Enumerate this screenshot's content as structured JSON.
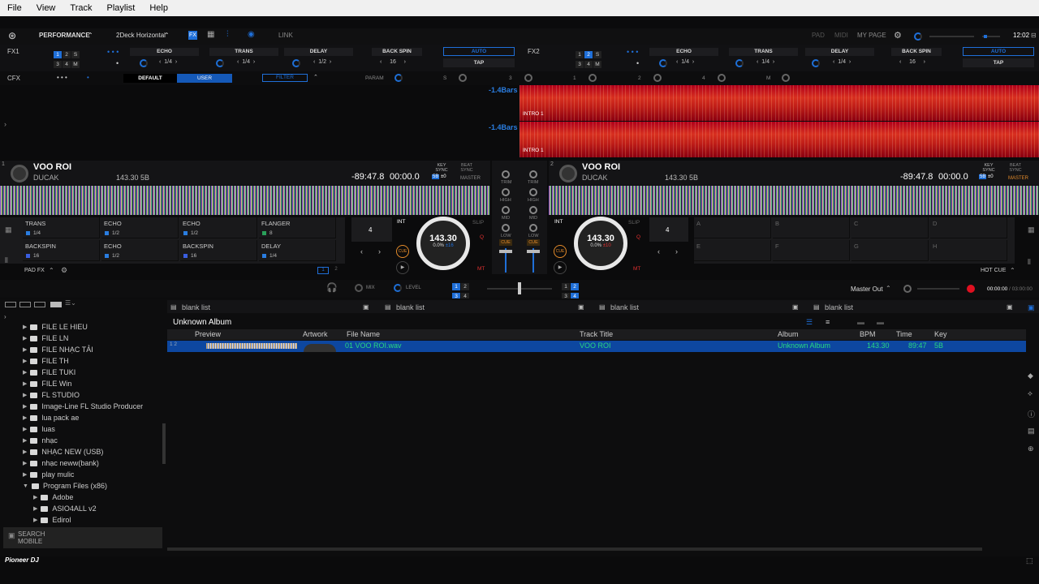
{
  "menu": [
    "File",
    "View",
    "Track",
    "Playlist",
    "Help"
  ],
  "topbar": {
    "mode": "PERFORMANCE",
    "layout": "2Deck Horizontal",
    "link": "LINK",
    "pad": "PAD",
    "midi": "MIDI",
    "mypage": "MY PAGE",
    "clock": "12:02"
  },
  "fx1": {
    "label": "FX1",
    "bank": [
      "1",
      "2",
      "S",
      "3",
      "4",
      "M"
    ],
    "slots": [
      {
        "name": "ECHO",
        "beat": "1/4"
      },
      {
        "name": "TRANS",
        "beat": "1/4"
      },
      {
        "name": "DELAY",
        "beat": "1/2"
      }
    ],
    "backspin": "BACK SPIN",
    "backspin_val": "16",
    "auto": "AUTO",
    "tap": "TAP"
  },
  "fx2": {
    "label": "FX2",
    "bank": [
      "1",
      "2",
      "S",
      "3",
      "4",
      "M"
    ],
    "slots": [
      {
        "name": "ECHO",
        "beat": "1/4"
      },
      {
        "name": "TRANS",
        "beat": "1/4"
      },
      {
        "name": "DELAY",
        "beat": "1/4"
      }
    ],
    "backspin": "BACK SPIN",
    "backspin_val": "16",
    "auto": "AUTO",
    "tap": "TAP"
  },
  "cfx": {
    "label": "CFX",
    "default": "DEFAULT",
    "user": "USER",
    "filter": "FILTER",
    "param": "PARAM",
    "s": "S",
    "nums": [
      "3",
      "1",
      "2",
      "4",
      "M"
    ]
  },
  "bars": "-1.4Bars",
  "intro": "INTRO 1",
  "deck1": {
    "num": "1",
    "title": "VOO ROI",
    "artist": "DUCAK",
    "bpmkey": "143.30 5B",
    "remain": "-89:47.8",
    "elapsed": "00:00.0",
    "keysync": "KEY SYNC",
    "beatsync": "BEAT SYNC",
    "master": "MASTER",
    "sb": "5B",
    "sb2": "±0",
    "loop": "4",
    "int": "INT",
    "slip": "SLIP",
    "cue": "CUE",
    "bpm": "143.30",
    "pitch": "0.0%",
    "range": "±16",
    "q": "Q",
    "mt": "MT",
    "padfx": "PAD FX",
    "pads": [
      {
        "label": "TRANS",
        "val": "1/4",
        "c": "#2a7de0"
      },
      {
        "label": "ECHO",
        "val": "1/2",
        "c": "#2a7de0"
      },
      {
        "label": "ECHO",
        "val": "1/2",
        "c": "#2a7de0"
      },
      {
        "label": "FLANGER",
        "val": "8",
        "c": "#2aa05a"
      },
      {
        "label": "BACKSPIN",
        "val": "16",
        "c": "#3a5ee0"
      },
      {
        "label": "ECHO",
        "val": "1/2",
        "c": "#2a7de0"
      },
      {
        "label": "BACKSPIN",
        "val": "16",
        "c": "#3a5ee0"
      },
      {
        "label": "DELAY",
        "val": "1/4",
        "c": "#2a7de0"
      }
    ],
    "page": [
      "1",
      "2"
    ]
  },
  "deck2": {
    "num": "2",
    "title": "VOO ROI",
    "artist": "DUCAK",
    "bpmkey": "143.30 5B",
    "remain": "-89:47.8",
    "elapsed": "00:00.0",
    "keysync": "KEY SYNC",
    "beatsync": "BEAT SYNC",
    "master": "MASTER",
    "sb": "5B",
    "sb2": "±0",
    "loop": "4",
    "int": "INT",
    "slip": "SLIP",
    "cue": "CUE",
    "bpm": "143.30",
    "pitch": "0.0%",
    "range": "±10",
    "q": "Q",
    "mt": "MT",
    "hotcue": "HOT CUE",
    "pads": [
      "A",
      "B",
      "C",
      "D",
      "E",
      "F",
      "G",
      "H"
    ]
  },
  "mixer": {
    "trim": "TRIM",
    "high": "HIGH",
    "mid": "MID",
    "low": "LOW",
    "cue": "CUE",
    "mix": "MIX",
    "level": "LEVEL",
    "masterout": "Master Out",
    "rec_time": "00:00:00",
    "rec_total": "/ 03:00:00",
    "xf_left": [
      "1",
      "2",
      "3",
      "4"
    ],
    "xf_right": [
      "1",
      "2",
      "3",
      "4"
    ]
  },
  "library": {
    "tree": [
      {
        "label": "FILE LE HIEU",
        "depth": 1
      },
      {
        "label": "FILE LN",
        "depth": 1
      },
      {
        "label": "FILE NHẠC TẢI",
        "depth": 1
      },
      {
        "label": "FILE TH",
        "depth": 1
      },
      {
        "label": "FILE TUKI",
        "depth": 1
      },
      {
        "label": "FILE Win",
        "depth": 1
      },
      {
        "label": "FL STUDIO",
        "depth": 1
      },
      {
        "label": "Image-Line FL Studio Producer",
        "depth": 1
      },
      {
        "label": "lua pack ae",
        "depth": 1
      },
      {
        "label": "luas",
        "depth": 1
      },
      {
        "label": "nhạc",
        "depth": 1
      },
      {
        "label": "NHẠC NEW (USB)",
        "depth": 1
      },
      {
        "label": "nhạc neww(bank)",
        "depth": 1
      },
      {
        "label": "play mulic",
        "depth": 1
      },
      {
        "label": "Program Files (x86)",
        "depth": 1,
        "open": true
      },
      {
        "label": "Adobe",
        "depth": 2
      },
      {
        "label": "ASIO4ALL v2",
        "depth": 2
      },
      {
        "label": "Edirol",
        "depth": 2
      }
    ],
    "search_mobile": [
      "SEARCH",
      "MOBILE"
    ],
    "tabs": [
      "blank list",
      "blank list",
      "blank list",
      "blank list"
    ],
    "folder_title": "Unknown Album",
    "columns": {
      "preview": "Preview",
      "artwork": "Artwork",
      "filename": "File Name",
      "title": "Track Title",
      "album": "Album",
      "bpm": "BPM",
      "time": "Time",
      "key": "Key"
    },
    "rows": [
      {
        "deck": "1 2",
        "filename": "01 VOO ROI.wav",
        "title": "VOO ROI",
        "album": "Unknown Album",
        "bpm": "143.30",
        "time": "89:47",
        "key": "5B"
      }
    ]
  },
  "footer": {
    "brand": "Pioneer DJ"
  },
  "colors": {
    "accent": "#1f6fd8",
    "waveform": "#c8201c",
    "selected_row": "#0d47a0",
    "row_text": "#28d880"
  }
}
